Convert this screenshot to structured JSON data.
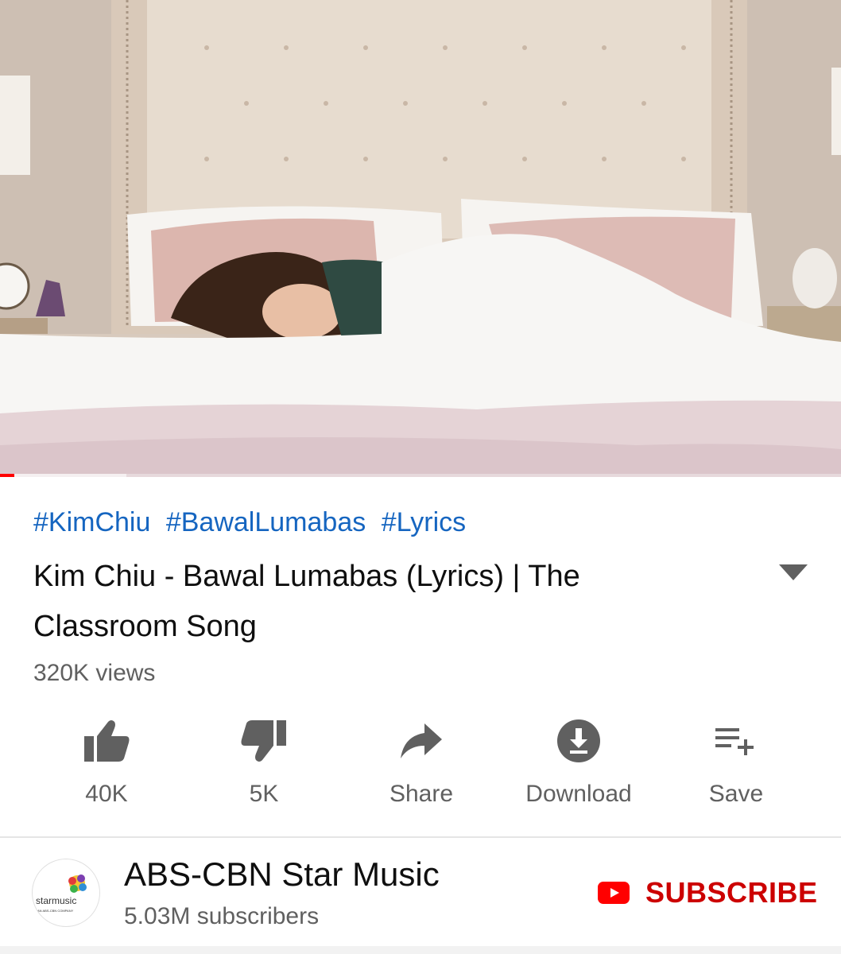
{
  "video": {
    "thumbnail": "woman-sleeping-in-bed-scene",
    "progress_fraction": 0.017,
    "buffer_fraction": 0.15
  },
  "details": {
    "hashtags": [
      "#KimChiu",
      "#BawalLumabas",
      "#Lyrics"
    ],
    "title": "Kim Chiu - Bawal Lumabas (Lyrics) | The Classroom Song",
    "views": "320K views",
    "expand_icon": "chevron-down-icon"
  },
  "actions": [
    {
      "icon": "thumbs-up-icon",
      "label": "40K"
    },
    {
      "icon": "thumbs-down-icon",
      "label": "5K"
    },
    {
      "icon": "share-icon",
      "label": "Share"
    },
    {
      "icon": "download-icon",
      "label": "Download"
    },
    {
      "icon": "save-playlist-icon",
      "label": "Save"
    }
  ],
  "channel": {
    "name": "ABS-CBN Star Music",
    "subscribers": "5.03M subscribers",
    "avatar_text": "starmusic",
    "avatar_subtext": "AN ABS-CBN COMPANY",
    "subscribe_label": "SUBSCRIBE",
    "subscribe_icon": "youtube-logo-icon"
  },
  "colors": {
    "link_blue": "#1565c0",
    "subscribe_red": "#cc0000",
    "icon_gray": "#606060",
    "progress_red": "#ff0000"
  }
}
